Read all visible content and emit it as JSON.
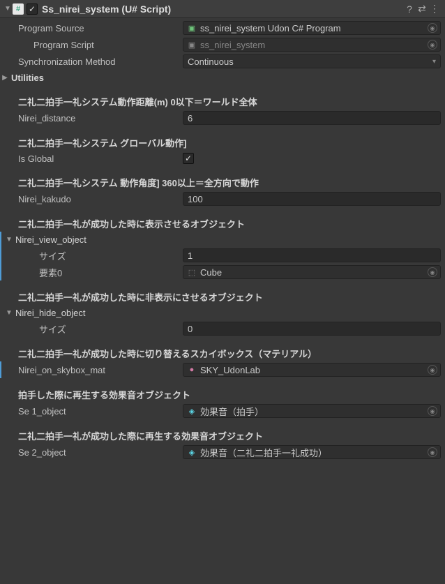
{
  "header": {
    "title": "Ss_nirei_system (U# Script)",
    "enabled": true
  },
  "program_source": {
    "label": "Program Source",
    "value": "ss_nirei_system Udon C# Program"
  },
  "program_script": {
    "label": "Program Script",
    "value": "ss_nirei_system"
  },
  "sync_method": {
    "label": "Synchronization Method",
    "value": "Continuous"
  },
  "utilities": {
    "label": "Utilities"
  },
  "sections": {
    "distance": {
      "header": "二礼二拍手一礼システム動作距離(m) 0以下＝ワールド全体",
      "label": "Nirei_distance",
      "value": "6"
    },
    "global": {
      "header": "二礼二拍手一礼システム グローバル動作]",
      "label": "Is Global",
      "value": true
    },
    "kakudo": {
      "header": "二礼二拍手一礼システム 動作角度] 360以上＝全方向で動作",
      "label": "Nirei_kakudo",
      "value": "100"
    },
    "view_obj": {
      "header": "二礼二拍手一礼が成功した時に表示させるオブジェクト",
      "label": "Nirei_view_object",
      "size_label": "サイズ",
      "size_value": "1",
      "elem0_label": "要素0",
      "elem0_value": "Cube"
    },
    "hide_obj": {
      "header": "二礼二拍手一礼が成功した時に非表示にさせるオブジェクト",
      "label": "Nirei_hide_object",
      "size_label": "サイズ",
      "size_value": "0"
    },
    "skybox": {
      "header": "二礼二拍手一礼が成功した時に切り替えるスカイボックス（マテリアル）",
      "label": "Nirei_on_skybox_mat",
      "value": "SKY_UdonLab"
    },
    "se1": {
      "header": "拍手した際に再生する効果音オブジェクト",
      "label": "Se 1_object",
      "value": "効果音（拍手）"
    },
    "se2": {
      "header": "二礼二拍手一礼が成功した際に再生する効果音オブジェクト",
      "label": "Se 2_object",
      "value": "効果音（二礼二拍手一礼成功）"
    }
  }
}
